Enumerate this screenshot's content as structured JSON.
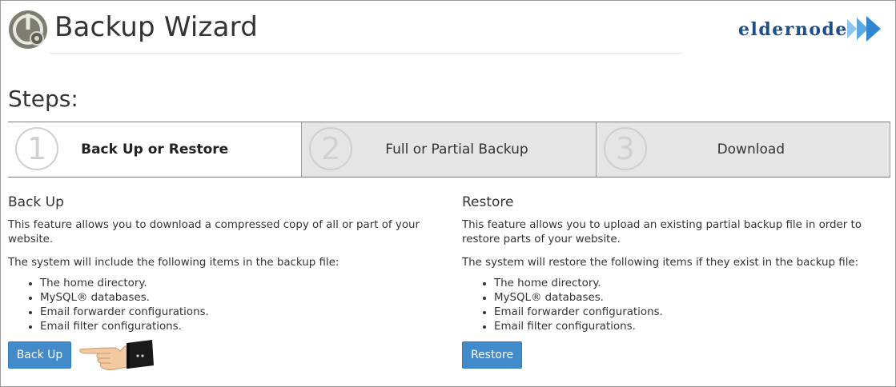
{
  "header": {
    "title": "Backup Wizard",
    "brand": "eldernode"
  },
  "steps": {
    "heading": "Steps:",
    "items": [
      {
        "number": "1",
        "label": "Back Up or Restore",
        "active": true
      },
      {
        "number": "2",
        "label": "Full or Partial Backup",
        "active": false
      },
      {
        "number": "3",
        "label": "Download",
        "active": false
      }
    ]
  },
  "backup": {
    "title": "Back Up",
    "description": "This feature allows you to download a compressed copy of all or part of your website.",
    "subheading": "The system will include the following items in the backup file:",
    "items": [
      "The home directory.",
      "MySQL® databases.",
      "Email forwarder configurations.",
      "Email filter configurations."
    ],
    "button_label": "Back Up"
  },
  "restore": {
    "title": "Restore",
    "description": "This feature allows you to upload an existing partial backup file in order to restore parts of your website.",
    "subheading": "The system will restore the following items if they exist in the backup file:",
    "items": [
      "The home directory.",
      "MySQL® databases.",
      "Email forwarder configurations.",
      "Email filter configurations."
    ],
    "button_label": "Restore"
  },
  "colors": {
    "accent": "#428bca",
    "brand": "#1d4e8c",
    "step_inactive_bg": "#e5e5e5"
  },
  "icons": {
    "app": "backup-wizard-icon",
    "brand_arrows": "arrows-icon",
    "pointer": "pointing-hand-icon"
  }
}
